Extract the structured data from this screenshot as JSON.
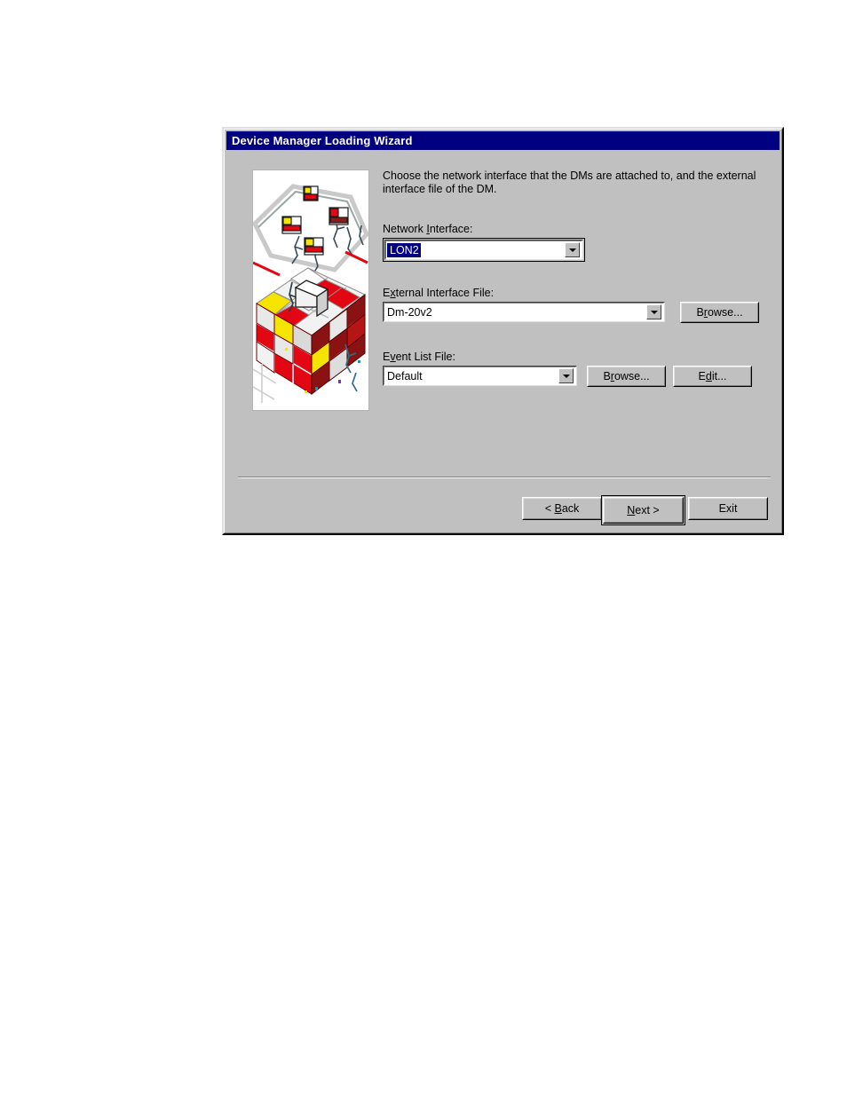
{
  "window": {
    "title": "Device Manager Loading Wizard",
    "titlebar_color": "#000080",
    "titlebar_text_color": "#ffffff",
    "face_color": "#c0c0c0"
  },
  "illustration": {
    "alt": "isometric illustration of figures assembling a large red and white cube"
  },
  "main": {
    "intro": "Choose the network interface that the DMs are attached to, and the external interface file of the DM.",
    "fields": [
      {
        "id": "network-interface",
        "label_pre": "Network ",
        "label_accel": "I",
        "label_post": "nterface:",
        "value": "LON2",
        "selected": true,
        "focused": true,
        "arrow_icon": "chevron-down-icon"
      },
      {
        "id": "external-interface-file",
        "label_pre": "E",
        "label_accel": "x",
        "label_post": "ternal Interface File:",
        "value": "Dm-20v2",
        "selected": false,
        "focused": false,
        "arrow_icon": "chevron-down-icon"
      },
      {
        "id": "event-list-file",
        "label_pre": "E",
        "label_accel": "v",
        "label_post": "ent List File:",
        "value": "Default",
        "selected": false,
        "focused": false,
        "arrow_icon": "chevron-down-icon"
      }
    ],
    "browse_external_label_pre": "B",
    "browse_external_label_accel": "r",
    "browse_external_label_post": "owse...",
    "browse_event_label_pre": "B",
    "browse_event_label_accel": "r",
    "browse_event_label_post": "owse...",
    "edit_label_pre": "E",
    "edit_label_accel": "d",
    "edit_label_post": "it..."
  },
  "footer": {
    "back_pre": "< ",
    "back_accel": "B",
    "back_post": "ack",
    "next_pre": "",
    "next_accel": "N",
    "next_post": "ext >",
    "exit_pre": "E",
    "exit_accel": "",
    "exit_post": "xit",
    "default_button": "next-button"
  }
}
